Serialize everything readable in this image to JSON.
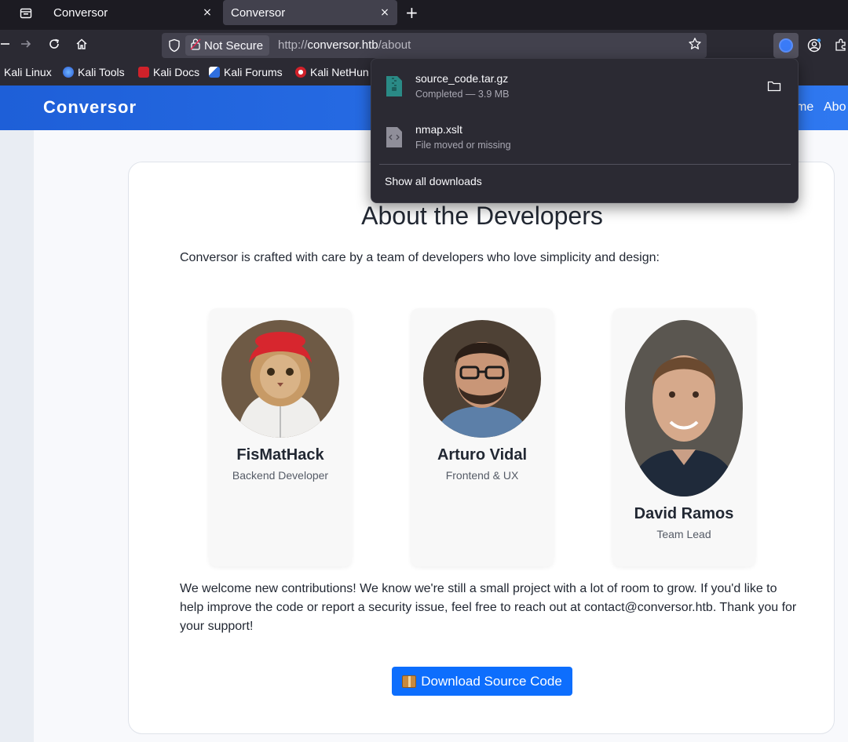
{
  "browser": {
    "tabs": [
      {
        "title": "Conversor",
        "active": false
      },
      {
        "title": "Conversor",
        "active": true
      }
    ],
    "new_tab_glyph": "+",
    "close_glyph": "×",
    "url_security": "Not Secure",
    "url_prefix": "http://",
    "url_host": "conversor.htb",
    "url_path": "/about",
    "bookmarks": [
      {
        "label": "Kali Linux",
        "icon": "kali-dragon-icon"
      },
      {
        "label": "Kali Tools",
        "icon": "kali-tools-icon"
      },
      {
        "label": "Kali Docs",
        "icon": "kali-docs-icon"
      },
      {
        "label": "Kali Forums",
        "icon": "kali-forums-icon"
      },
      {
        "label": "Kali NetHun",
        "icon": "kali-nethunter-icon"
      }
    ]
  },
  "downloads": {
    "items": [
      {
        "name": "source_code.tar.gz",
        "status": "Completed — 3.9 MB",
        "icon": "archive-file-icon",
        "color": "#2a8a86"
      },
      {
        "name": "nmap.xslt",
        "status": "File moved or missing",
        "icon": "code-file-icon",
        "color": "#8f8e99"
      }
    ],
    "show_all": "Show all downloads"
  },
  "site": {
    "brand": "Conversor",
    "nav": [
      "me",
      "Abo"
    ]
  },
  "about": {
    "title": "About the Developers",
    "intro": "Conversor is crafted with care by a team of developers who love simplicity and design:",
    "developers": [
      {
        "name": "FisMatHack",
        "role": "Backend Developer"
      },
      {
        "name": "Arturo Vidal",
        "role": "Frontend & UX"
      },
      {
        "name": "David Ramos",
        "role": "Team Lead"
      }
    ],
    "outro": "We welcome new contributions! We know we're still a small project with a lot of room to grow. If you'd like to help improve the code or report a security issue, feel free to reach out at contact@conversor.htb. Thank you for your support!",
    "download_button": "Download Source Code"
  },
  "colors": {
    "header_blue": "#1e5fd8",
    "button_blue": "#0d6efd",
    "chrome_dark": "#2b2a33"
  }
}
